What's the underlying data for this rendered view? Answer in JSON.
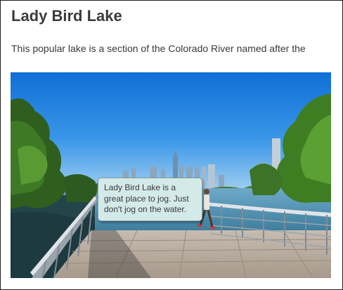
{
  "page": {
    "title": "Lady Bird Lake",
    "intro": "This popular lake is a section of the Colorado River named after the"
  },
  "photo": {
    "subject": "boardwalk-over-lake-with-skyline"
  },
  "tooltip": {
    "text": "Lady Bird Lake is a great place to jog. Just don't jog on the water."
  },
  "colors": {
    "sky": "#1f86e0",
    "water": "#2e5c66",
    "tooltip_bg": "#d3eae9",
    "text": "#3a3a3a"
  }
}
